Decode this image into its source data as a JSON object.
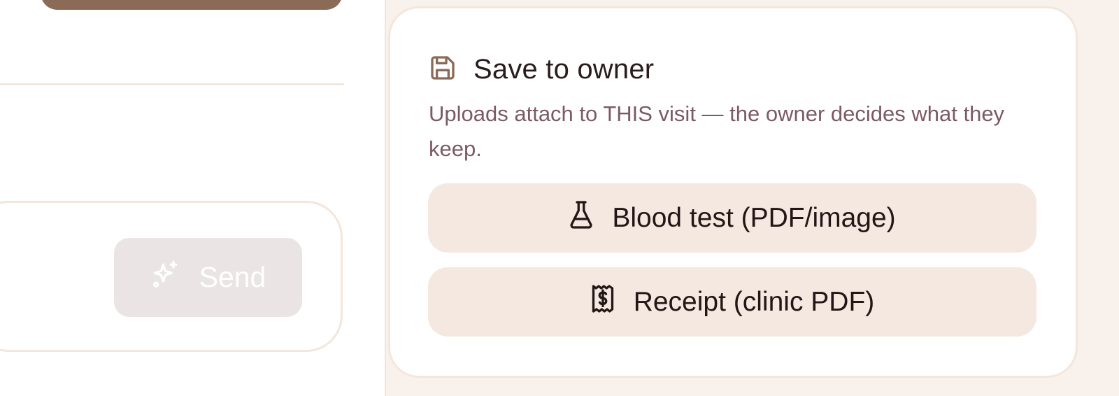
{
  "composer": {
    "send_label": "Send"
  },
  "save_card": {
    "title": "Save to owner",
    "description": "Uploads attach to THIS visit — the owner decides what they keep.",
    "buttons": [
      {
        "label": "Blood test (PDF/image)",
        "icon": "flask-icon"
      },
      {
        "label": "Receipt (clinic PDF)",
        "icon": "receipt-icon"
      }
    ]
  },
  "colors": {
    "accent_brown": "#8b6a58",
    "button_bg": "#f4e8e0",
    "muted_text": "#7b5a64",
    "disabled_button": "#ebe4e4"
  }
}
